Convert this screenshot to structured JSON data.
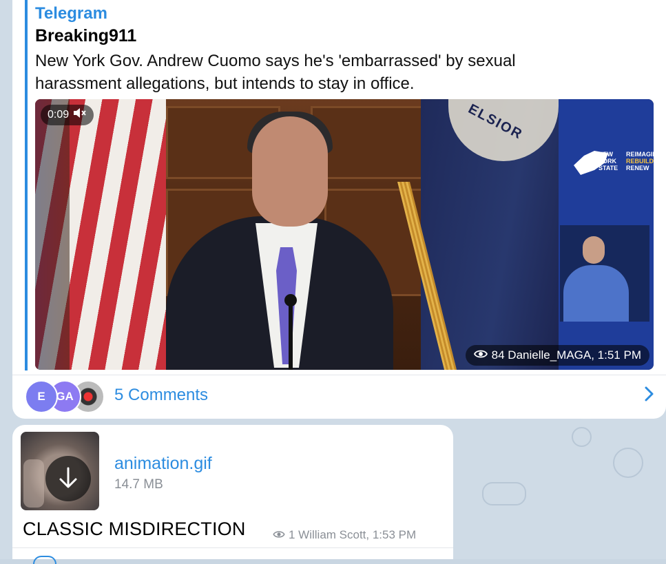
{
  "message1": {
    "source_title": "Telegram",
    "channel": "Breaking911",
    "text": "New York Gov. Andrew Cuomo says he's 'embarrassed' by sexual harassment allegations, but intends to stay in office.",
    "video": {
      "duration": "0:09",
      "mute_icon": "speaker-muted-icon",
      "seal_text": "ELSIOR",
      "logo_lines": [
        "NEW",
        "YORK",
        "STATE"
      ],
      "logo_tagline": [
        "REIMAGINE",
        "REBUILD",
        "RENEW"
      ],
      "views_icon": "eye-icon",
      "meta": "84 Danielle_MAGA, 1:51 PM"
    },
    "comments": {
      "avatars": [
        "E",
        "GA"
      ],
      "label": "5 Comments",
      "chevron_icon": "chevron-right-icon"
    }
  },
  "message2": {
    "file_name": "animation.gif",
    "file_size": "14.7 MB",
    "download_icon": "download-arrow-icon",
    "text": "CLASSIC MISDIRECTION",
    "views_icon": "eye-icon",
    "meta": "1 William Scott, 1:53 PM"
  },
  "colors": {
    "accent": "#2c8ce0",
    "bubble": "#ffffff",
    "background": "#cfdbe6",
    "muted": "#8a8f96"
  }
}
